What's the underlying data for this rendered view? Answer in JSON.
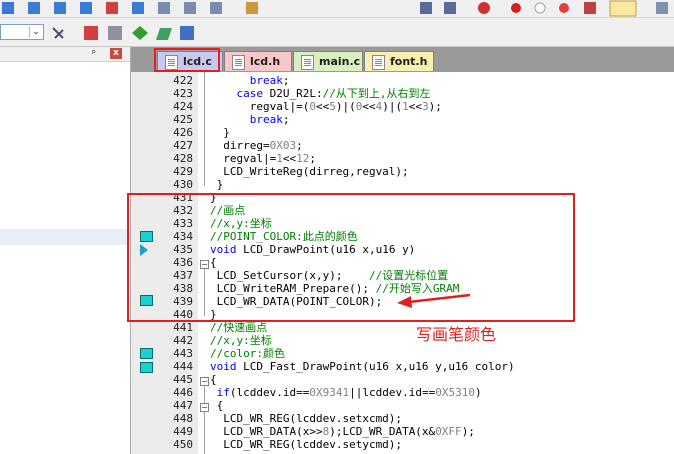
{
  "tabs": [
    {
      "label": "lcd.c",
      "color": "#c8c8f0",
      "active": true
    },
    {
      "label": "lcd.h",
      "color": "#f8c8c8",
      "active": false
    },
    {
      "label": "main.c",
      "color": "#d8f0c0",
      "active": false
    },
    {
      "label": "font.h",
      "color": "#f8f0b0",
      "active": false
    }
  ],
  "left_panel": {
    "pin": "ᵖ",
    "close": "x"
  },
  "code_lines": [
    {
      "n": "422",
      "html": "      <span class='kw'>break</span>;"
    },
    {
      "n": "423",
      "html": "    <span class='kw'>case</span> D2U_R2L:<span class='cm'>//从下到上,从右到左</span>"
    },
    {
      "n": "424",
      "html": "      regval|=(<span class='nm'>0</span>&lt;&lt;<span class='nm'>5</span>)|(<span class='nm'>0</span>&lt;&lt;<span class='nm'>4</span>)|(<span class='nm'>1</span>&lt;&lt;<span class='nm'>3</span>);"
    },
    {
      "n": "425",
      "html": "      <span class='kw'>break</span>;"
    },
    {
      "n": "426",
      "html": "  }"
    },
    {
      "n": "427",
      "html": "  dirreg=<span class='nm'>0X03</span>;"
    },
    {
      "n": "428",
      "html": "  regval|=<span class='nm'>1</span>&lt;&lt;<span class='nm'>12</span>;"
    },
    {
      "n": "429",
      "html": "  LCD_WriteReg(dirreg,regval);"
    },
    {
      "n": "430",
      "html": " }"
    },
    {
      "n": "431",
      "html": "}"
    },
    {
      "n": "432",
      "html": "<span class='cm'>//画点</span>"
    },
    {
      "n": "433",
      "html": "<span class='cm'>//x,y:坐标</span>"
    },
    {
      "n": "434",
      "html": "<span class='cm'>//POINT_COLOR:此点的颜色</span>"
    },
    {
      "n": "435",
      "html": "<span class='kw'>void</span> LCD_DrawPoint(u16 x,u16 y)"
    },
    {
      "n": "436",
      "html": "{"
    },
    {
      "n": "437",
      "html": " LCD_SetCursor(x,y);    <span class='cm'>//设置光标位置</span>"
    },
    {
      "n": "438",
      "html": " LCD_WriteRAM_Prepare(); <span class='cm'>//开始写入GRAM</span>"
    },
    {
      "n": "439",
      "html": " LCD_WR_DATA(POINT_COLOR);"
    },
    {
      "n": "440",
      "html": "}"
    },
    {
      "n": "441",
      "html": "<span class='cm'>//快速画点</span>"
    },
    {
      "n": "442",
      "html": "<span class='cm'>//x,y:坐标</span>"
    },
    {
      "n": "443",
      "html": "<span class='cm'>//color:颜色</span>"
    },
    {
      "n": "444",
      "html": "<span class='kw'>void</span> LCD_Fast_DrawPoint(u16 x,u16 y,u16 color)"
    },
    {
      "n": "445",
      "html": "{"
    },
    {
      "n": "446",
      "html": " <span class='kw'>if</span>(lcddev.id==<span class='nm'>0X9341</span>||lcddev.id==<span class='nm'>0X5310</span>)"
    },
    {
      "n": "447",
      "html": " {"
    },
    {
      "n": "448",
      "html": "  LCD_WR_REG(lcddev.setxcmd);"
    },
    {
      "n": "449",
      "html": "  LCD_WR_DATA(x&gt;&gt;<span class='nm'>8</span>);LCD_WR_DATA(x&amp;<span class='nm'>0XFF</span>);"
    },
    {
      "n": "450",
      "html": "  LCD_WR_REG(lcddev.setycmd);"
    }
  ],
  "annotation": "写画笔颜色",
  "colors": {
    "highlight": "#e02020",
    "bookmark": "#1ad1d1",
    "keyword": "#0000ff",
    "comment": "#008000"
  }
}
